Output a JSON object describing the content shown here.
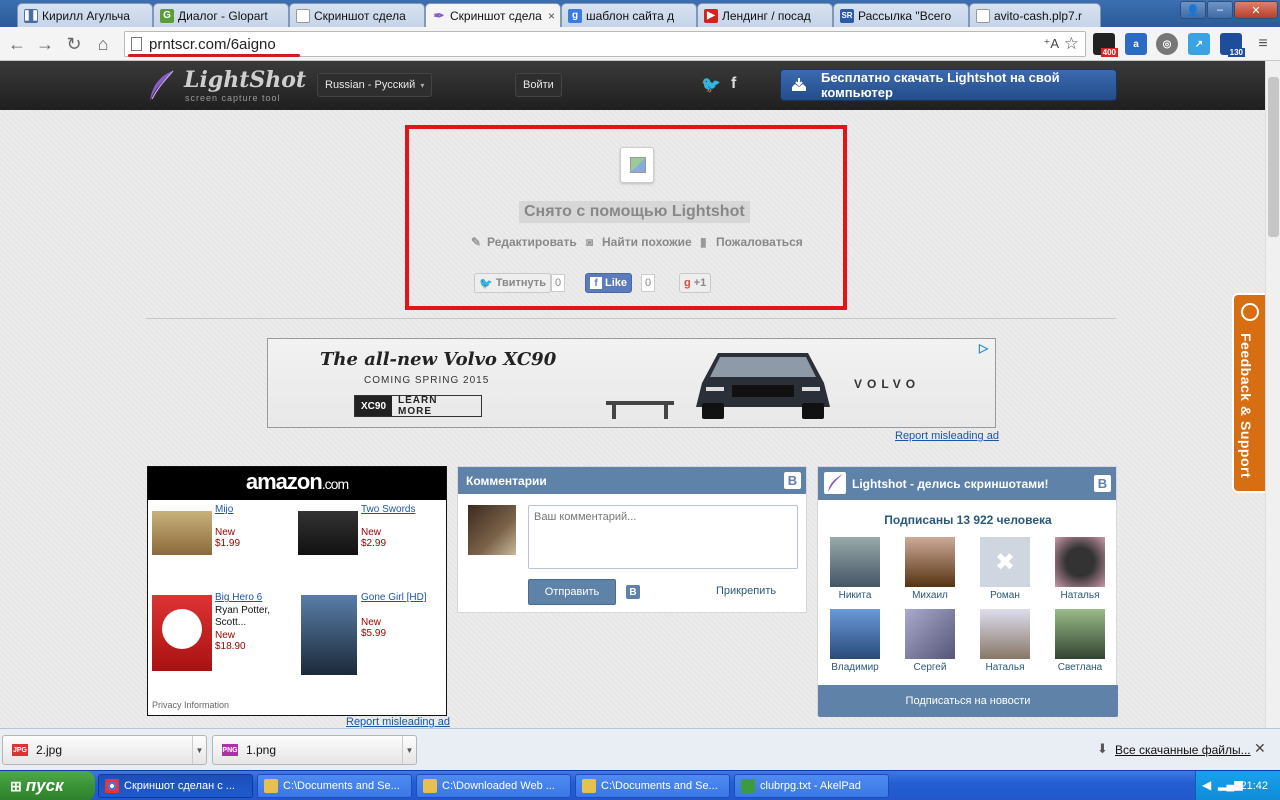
{
  "browser": {
    "tabs": [
      {
        "title": "Кирилл Агульча",
        "icon": "pause-icon",
        "color": "#4a6fa5"
      },
      {
        "title": "Диалог - Glopart",
        "icon": "glopart-icon",
        "color": "#5a9e3a"
      },
      {
        "title": "Скриншот сдела",
        "icon": "page-icon",
        "color": "#ffffff"
      },
      {
        "title": "Скриншот сдела",
        "icon": "lightshot-icon",
        "color": "#8a5cc8",
        "active": true
      },
      {
        "title": "шаблон сайта д",
        "icon": "google-icon",
        "color": "#3b7ae0"
      },
      {
        "title": "Лендинг / посад",
        "icon": "youtube-icon",
        "color": "#d32020"
      },
      {
        "title": "Рассылка \"Всего",
        "icon": "sr-icon",
        "color": "#2a5aa8"
      },
      {
        "title": "avito-cash.plp7.r",
        "icon": "page-icon",
        "color": "#ffffff"
      }
    ],
    "url_host": "prntscr.com/",
    "url_path": "6aigno",
    "ext_badges": [
      "400",
      "130"
    ]
  },
  "header": {
    "logo_name": "LightShot",
    "logo_tagline": "screen capture tool",
    "language": "Russian - Русский",
    "login": "Войти",
    "twitter": "t",
    "facebook": "f",
    "download_button": "Бесплатно скачать Lightshot на свой компьютер"
  },
  "screenshot": {
    "credit": "Снято с помощью Lightshot",
    "actions": [
      "Редактировать",
      "Найти похожие",
      "Пожаловаться"
    ],
    "tweet": "Твитнуть",
    "tweet_count": "0",
    "like": "Like",
    "like_count": "0",
    "gplus": "+1"
  },
  "ad": {
    "title": "The all-new Volvo XC90",
    "subtitle": "COMING SPRING 2015",
    "model": "XC90",
    "learn_more": "LEARN MORE",
    "brand": "VOLVO",
    "report": "Report misleading ad"
  },
  "amazon": {
    "logo": "amazon",
    "logo_suffix": ".com",
    "products": [
      {
        "name": "Mijo",
        "desc": "",
        "price": "New $1.99"
      },
      {
        "name": "Two Swords",
        "desc": "",
        "price": "New $2.99"
      },
      {
        "name": "Big Hero 6",
        "desc": "Ryan Potter, Scott...",
        "price": "New $18.90"
      },
      {
        "name": "Gone Girl [HD]",
        "desc": "",
        "price": "New $5.99"
      }
    ],
    "privacy": "Privacy Information",
    "report": "Report misleading ad"
  },
  "comments": {
    "title": "Комментарии",
    "vk": "B",
    "placeholder": "Ваш комментарий...",
    "send": "Отправить",
    "attach": "Прикрепить"
  },
  "group": {
    "title": "Lightshot - делись скриншотами!",
    "vk": "B",
    "subscribers": "Подписаны 13 922 человека",
    "members": [
      "Никита",
      "Михаил",
      "Роман",
      "Наталья",
      "Владимир",
      "Сергей",
      "Наталья",
      "Светлана"
    ],
    "subscribe": "Подписаться на новости"
  },
  "feedback": "Feedback & Support",
  "downloads": {
    "items": [
      {
        "name": "2.jpg",
        "type": "JPG"
      },
      {
        "name": "1.png",
        "type": "PNG"
      }
    ],
    "all": "Все скачанные файлы..."
  },
  "taskbar": {
    "start": "пуск",
    "tasks": [
      "Скриншот сделан с ...",
      "C:\\Documents and Se...",
      "C:\\Downloaded Web ...",
      "C:\\Documents and Se...",
      "clubrpg.txt - AkelPad"
    ],
    "time": "21:42"
  }
}
